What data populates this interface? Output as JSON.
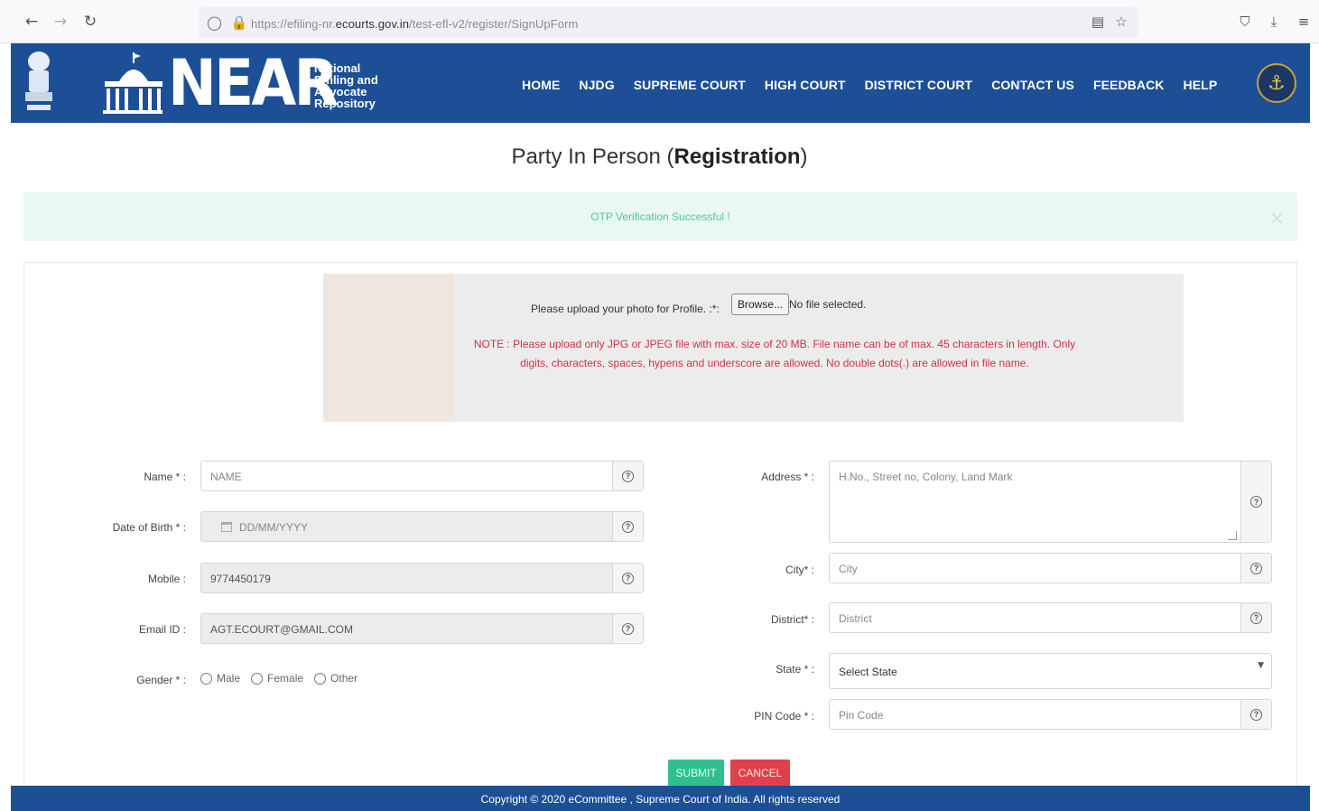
{
  "browser": {
    "url_prefix": "https://efiling-nr.",
    "url_domain": "ecourts.gov.in",
    "url_path": "/test-efl-v2/register/SignUpForm"
  },
  "header": {
    "logo_text": "NEAR",
    "logo_subtitle": [
      "National",
      "E-filing and",
      "Advocate",
      "Repository"
    ],
    "nav": [
      "HOME",
      "NJDG",
      "SUPREME COURT",
      "HIGH COURT",
      "DISTRICT COURT",
      "CONTACT US",
      "FEEDBACK",
      "HELP"
    ]
  },
  "page": {
    "title_normal": "Party In Person (",
    "title_bold": "Registration",
    "title_end": ")"
  },
  "alert": {
    "message": "OTP Verification Successful !",
    "close": "×"
  },
  "upload": {
    "label": "Please upload your photo for Profile. :*:",
    "browse_label": "Browse...",
    "file_status": "No file selected.",
    "note_line1": "NOTE : Please upload only JPG or JPEG file with max. size of 20 MB. File name can be of max. 45 characters in length. Only",
    "note_line2": "digits, characters, spaces, hypens and underscore are allowed. No double dots(.) are allowed in file name."
  },
  "form": {
    "name": {
      "label": "Name * :",
      "placeholder": "NAME",
      "value": ""
    },
    "dob": {
      "label": "Date of Birth * :",
      "placeholder": "DD/MM/YYYY",
      "value": ""
    },
    "mobile": {
      "label": "Mobile :",
      "value": "9774450179"
    },
    "email": {
      "label": "Email ID :",
      "value": "AGT.ECOURT@GMAIL.COM"
    },
    "gender": {
      "label": "Gender * :",
      "options": [
        "Male",
        "Female",
        "Other"
      ]
    },
    "address": {
      "label": "Address * :",
      "placeholder": "H.No., Street no, Colony, Land Mark"
    },
    "city": {
      "label": "City* :",
      "placeholder": "City"
    },
    "district": {
      "label": "District* :",
      "placeholder": "District"
    },
    "state": {
      "label": "State * :",
      "selected": "Select State"
    },
    "pincode": {
      "label": "PIN Code * :",
      "placeholder": "Pin Code"
    }
  },
  "buttons": {
    "submit": "SUBMIT",
    "cancel": "CANCEL"
  },
  "footer": {
    "text": "Copyright © 2020 eCommittee , Supreme Court of India. All rights reserved"
  },
  "colors": {
    "header_bg": "#1d4f97",
    "alert_bg": "#e9f8f1",
    "alert_text": "#4fc79b",
    "note_text": "#d0304a",
    "submit_bg": "#2fbf8f",
    "cancel_bg": "#e0404b"
  }
}
